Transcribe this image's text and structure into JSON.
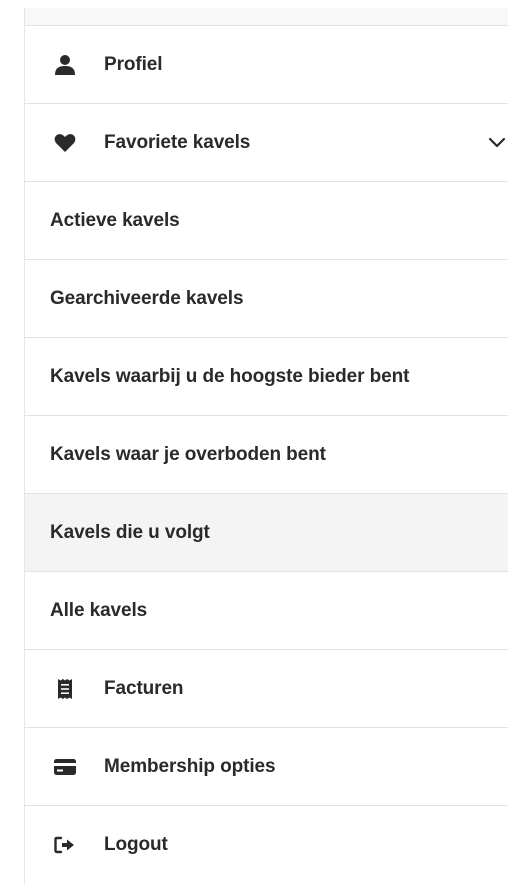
{
  "menu": {
    "items": [
      {
        "label": "Profiel",
        "icon": "user-icon"
      },
      {
        "label": "Favoriete kavels",
        "icon": "heart-icon",
        "expanded": true
      },
      {
        "label": "Actieve kavels"
      },
      {
        "label": "Gearchiveerde kavels"
      },
      {
        "label": "Kavels waarbij u de hoogste bieder bent"
      },
      {
        "label": "Kavels waar je overboden bent"
      },
      {
        "label": "Kavels die u volgt",
        "highlighted": true
      },
      {
        "label": "Alle kavels"
      },
      {
        "label": "Facturen",
        "icon": "receipt-icon"
      },
      {
        "label": "Membership opties",
        "icon": "credit-card-icon"
      },
      {
        "label": "Logout",
        "icon": "logout-icon"
      }
    ]
  },
  "colors": {
    "text": "#2a2a2a",
    "divider": "#e3e3e3",
    "highlight_bg": "#f4f4f5"
  }
}
